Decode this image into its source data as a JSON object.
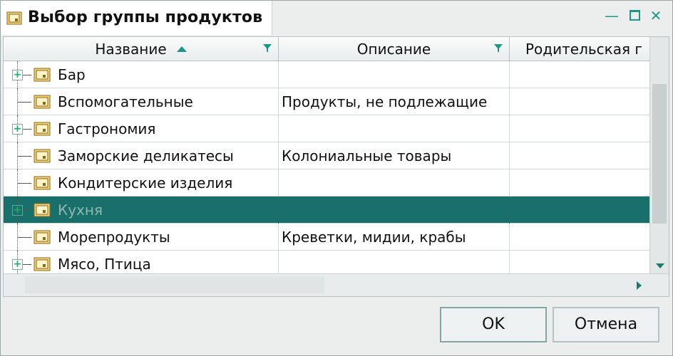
{
  "window": {
    "title": "Выбор группы продуктов"
  },
  "grid": {
    "columns": [
      {
        "label": "Название"
      },
      {
        "label": "Описание"
      },
      {
        "label": "Родительская г"
      }
    ],
    "rows": [
      {
        "name": "Бар",
        "description": "",
        "expandable": true
      },
      {
        "name": "Вспомогательные",
        "description": "Продукты, не подлежащие",
        "expandable": false
      },
      {
        "name": "Гастрономия",
        "description": "",
        "expandable": true
      },
      {
        "name": "Заморские деликатесы",
        "description": "Колониальные товары",
        "expandable": false
      },
      {
        "name": "Кондитерские изделия",
        "description": "",
        "expandable": false
      },
      {
        "name": "Кухня",
        "description": "",
        "expandable": true,
        "selected": true
      },
      {
        "name": "Морепродукты",
        "description": "Креветки, мидии, крабы",
        "expandable": false
      },
      {
        "name": "Мясо, Птица",
        "description": "",
        "expandable": true
      }
    ]
  },
  "buttons": {
    "ok": "OK",
    "cancel": "Отмена"
  },
  "colors": {
    "accent": "#1a9a86",
    "selection": "#19706a"
  },
  "icons": [
    "folder-icon",
    "sort-ascending-icon",
    "filter-icon",
    "minimize-icon",
    "maximize-icon",
    "close-icon",
    "expand-icon"
  ]
}
